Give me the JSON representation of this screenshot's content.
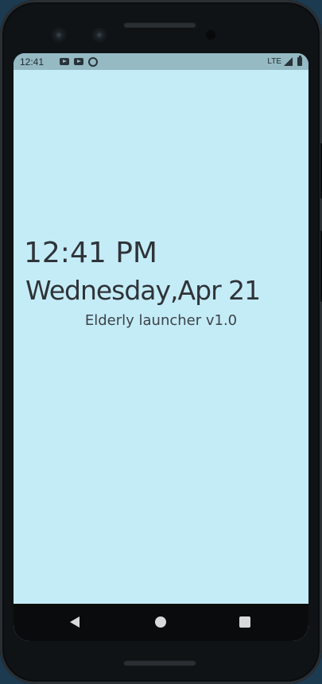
{
  "status_bar": {
    "time": "12:41",
    "network": "LTE",
    "notification_icons": [
      "youtube-icon",
      "youtube-icon",
      "sync-icon"
    ],
    "right_icons": [
      "signal-icon",
      "battery-icon"
    ]
  },
  "launcher": {
    "time": "12:41 PM",
    "date": "Wednesday,Apr 21",
    "app_version": "Elderly launcher v1.0"
  },
  "navigation": {
    "buttons": [
      "back",
      "home",
      "recents"
    ]
  },
  "colors": {
    "screen_background": "#c4ecf7",
    "status_bar": "#95bac3",
    "text": "#2f3338",
    "nav_bar": "#0a0b0c"
  }
}
